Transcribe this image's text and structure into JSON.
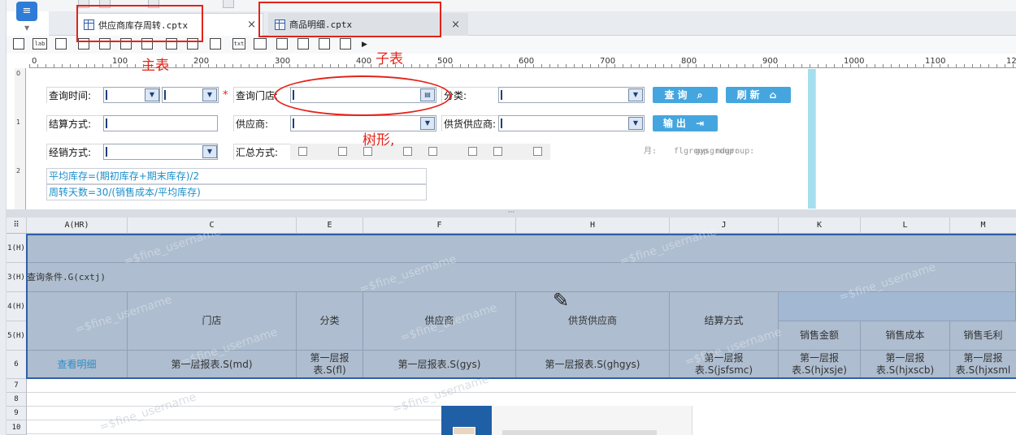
{
  "tabs": [
    {
      "label": "供应商库存周转.cptx",
      "close": "×"
    },
    {
      "label": "商品明细.cptx",
      "close": "×"
    }
  ],
  "annotations": {
    "main_table": "主表",
    "sub_table": "子表",
    "tree_note": "树形,"
  },
  "ruler_ticks": [
    "0",
    "100",
    "200",
    "300",
    "400",
    "500",
    "600",
    "700",
    "800",
    "900",
    "1000",
    "1100",
    "12"
  ],
  "vruler": [
    "0",
    "1",
    "2"
  ],
  "params": {
    "query_time": "查询时间:",
    "query_store": "查询门店:",
    "category": "分类:",
    "settle_mode": "结算方式:",
    "supplier": "供应商:",
    "goods_supplier": "供货供应商:",
    "sales_mode": "经销方式:",
    "summary_mode": "汇总方式:",
    "required_mark": "*",
    "month_label": "月:",
    "faint_flgroup": "flgroup",
    "faint_gysgroup": "gysgroup:",
    "faint_mdgroup": "mdgroup:"
  },
  "buttons": {
    "query": "查询",
    "refresh": "刷新",
    "export": "输出"
  },
  "formulas": [
    "平均库存=(期初库存+期末库存)/2",
    "周转天数=30/(销售成本/平均库存)"
  ],
  "grid": {
    "columns": [
      "A(HR)",
      "C",
      "E",
      "F",
      "H",
      "J",
      "K",
      "L",
      "M"
    ],
    "rows": [
      "1(H)",
      "3(H)",
      "4(H)",
      "5(H)",
      "6",
      "7",
      "8",
      "9",
      "10"
    ],
    "query_condition": "查询条件.G(cxtj)",
    "headers": {
      "store": "门店",
      "category": "分类",
      "supplier": "供应商",
      "goods_supplier": "供货供应商",
      "settle": "结算方式",
      "sales_amount": "销售金额",
      "sales_cost": "销售成本",
      "sales_profit": "销售毛利"
    },
    "row6": {
      "link": "查看明细",
      "md": "第一层报表.S(md)",
      "fl": "第一层报表.S(fl)",
      "gys": "第一层报表.S(gys)",
      "ghgys": "第一层报表.S(ghgys)",
      "jsfsmc": "第一层报表.S(jsfsmc)",
      "hjxsje": "第一层报表.S(hjxsje)",
      "hjxscb": "第一层报表.S(hjxscb)",
      "hjxsml": "第一层报表.S(hjxsml"
    },
    "watermark": "=$fine_username"
  },
  "colors": {
    "accent": "#45a6df",
    "selection": "#aebdcf",
    "annotation": "#e3231a"
  },
  "icons": [
    "app-logo-icon",
    "tab-report-icon",
    "close-icon",
    "search-icon",
    "refresh-icon",
    "export-icon",
    "dropdown-icon",
    "calendar-icon",
    "pencil-icon"
  ]
}
